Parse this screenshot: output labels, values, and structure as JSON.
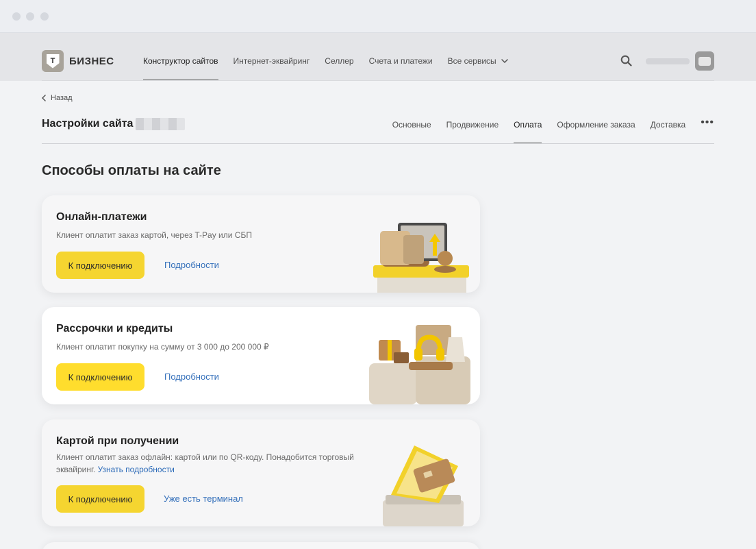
{
  "header": {
    "logo_letter": "Т",
    "logo_text": "БИЗНЕС",
    "nav": [
      {
        "label": "Конструктор сайтов",
        "active": true
      },
      {
        "label": "Интернет-эквайринг",
        "active": false
      },
      {
        "label": "Селлер",
        "active": false
      },
      {
        "label": "Счета и платежи",
        "active": false
      },
      {
        "label": "Все сервисы",
        "active": false
      }
    ]
  },
  "back_label": "Назад",
  "settings": {
    "title": "Настройки сайта",
    "tabs": [
      {
        "label": "Основные"
      },
      {
        "label": "Продвижение"
      },
      {
        "label": "Оплата"
      },
      {
        "label": "Оформление заказа"
      },
      {
        "label": "Доставка"
      }
    ],
    "more_label": "•••"
  },
  "section_title": "Способы оплаты на сайте",
  "cards": [
    {
      "title": "Онлайн-платежи",
      "description": "Клиент оплатит заказ картой, через T-Pay или СБП",
      "button": "К подключению",
      "link": "Подробности"
    },
    {
      "title": "Рассрочки и кредиты",
      "description": "Клиент оплатит покупку на сумму от 3 000 до 200 000 ₽",
      "button": "К подключению",
      "link": "Подробности"
    },
    {
      "title": "Картой при получении",
      "description": "Клиент оплатит заказ офлайн: картой или по QR-коду. Понадобится торговый эквайринг.",
      "description_link": "Узнать подробности",
      "button": "К подключению",
      "link": "Уже есть терминал"
    }
  ],
  "colors": {
    "accent_yellow": "#ffdd2d",
    "link_blue": "#336fba",
    "background": "#f2f3f5"
  }
}
